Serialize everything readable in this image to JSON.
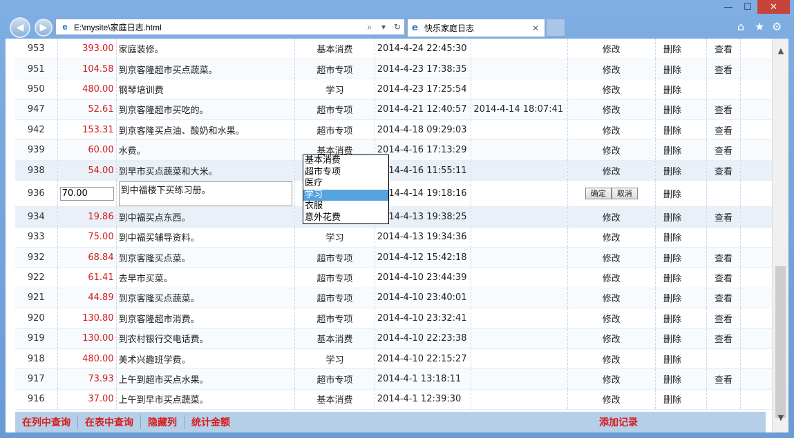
{
  "browser": {
    "address": "E:\\mysite\\家庭日志.html",
    "tab_title": "快乐家庭日志",
    "minimize": "—",
    "maximize": "☐",
    "close": "✕"
  },
  "rows": [
    {
      "id": "953",
      "amount": "393.00",
      "desc": "家庭装修。",
      "cat": "基本消费",
      "time": "2014-4-24 22:45:30",
      "time2": "",
      "edit": "修改",
      "del": "删除",
      "view": "查看"
    },
    {
      "id": "951",
      "amount": "104.58",
      "desc": "到京客隆超市买点蔬菜。",
      "cat": "超市专项",
      "time": "2014-4-23 17:38:35",
      "time2": "",
      "edit": "修改",
      "del": "删除",
      "view": "查看"
    },
    {
      "id": "950",
      "amount": "480.00",
      "desc": "钢琴培训费",
      "cat": "学习",
      "time": "2014-4-23 17:25:54",
      "time2": "",
      "edit": "修改",
      "del": "删除",
      "view": ""
    },
    {
      "id": "947",
      "amount": "52.61",
      "desc": "到京客隆超市买吃的。",
      "cat": "超市专项",
      "time": "2014-4-21 12:40:57",
      "time2": "2014-4-14 18:07:41",
      "edit": "修改",
      "del": "删除",
      "view": "查看"
    },
    {
      "id": "942",
      "amount": "153.31",
      "desc": "到京客隆买点油、酸奶和水果。",
      "cat": "超市专项",
      "time": "2014-4-18 09:29:03",
      "time2": "",
      "edit": "修改",
      "del": "删除",
      "view": "查看"
    },
    {
      "id": "939",
      "amount": "60.00",
      "desc": "水费。",
      "cat": "基本消费",
      "time": "2014-4-16 17:13:29",
      "time2": "",
      "edit": "修改",
      "del": "删除",
      "view": "查看"
    },
    {
      "id": "938",
      "amount": "54.00",
      "desc": "到早市买点蔬菜和大米。",
      "cat": "",
      "time": "2014-4-16 11:55:11",
      "time2": "",
      "edit": "修改",
      "del": "删除",
      "view": "查看"
    },
    {
      "id": "934",
      "amount": "19.86",
      "desc": "到中福买点东西。",
      "cat": "",
      "time": "2014-4-13 19:38:25",
      "time2": "",
      "edit": "修改",
      "del": "删除",
      "view": "查看"
    },
    {
      "id": "933",
      "amount": "75.00",
      "desc": "到中福买辅导资料。",
      "cat": "学习",
      "time": "2014-4-13 19:34:36",
      "time2": "",
      "edit": "修改",
      "del": "删除",
      "view": ""
    },
    {
      "id": "932",
      "amount": "68.84",
      "desc": "到京客隆买点菜。",
      "cat": "超市专项",
      "time": "2014-4-12 15:42:18",
      "time2": "",
      "edit": "修改",
      "del": "删除",
      "view": "查看"
    },
    {
      "id": "922",
      "amount": "61.41",
      "desc": "去早市买菜。",
      "cat": "超市专项",
      "time": "2014-4-10 23:44:39",
      "time2": "",
      "edit": "修改",
      "del": "删除",
      "view": "查看"
    },
    {
      "id": "921",
      "amount": "44.89",
      "desc": "到京客隆买点蔬菜。",
      "cat": "超市专项",
      "time": "2014-4-10 23:40:01",
      "time2": "",
      "edit": "修改",
      "del": "删除",
      "view": "查看"
    },
    {
      "id": "920",
      "amount": "130.80",
      "desc": "到京客隆超市消费。",
      "cat": "超市专项",
      "time": "2014-4-10 23:32:41",
      "time2": "",
      "edit": "修改",
      "del": "删除",
      "view": "查看"
    },
    {
      "id": "919",
      "amount": "130.00",
      "desc": "到农村银行交电话费。",
      "cat": "基本消费",
      "time": "2014-4-10 22:23:38",
      "time2": "",
      "edit": "修改",
      "del": "删除",
      "view": "查看"
    },
    {
      "id": "918",
      "amount": "480.00",
      "desc": "美术兴趣班学费。",
      "cat": "学习",
      "time": "2014-4-10 22:15:27",
      "time2": "",
      "edit": "修改",
      "del": "删除",
      "view": ""
    },
    {
      "id": "917",
      "amount": "73.93",
      "desc": "上午到超市买点水果。",
      "cat": "超市专项",
      "time": "2014-4-1 13:18:11",
      "time2": "",
      "edit": "修改",
      "del": "删除",
      "view": "查看"
    },
    {
      "id": "916",
      "amount": "37.00",
      "desc": "上午到早市买点蔬菜。",
      "cat": "基本消费",
      "time": "2014-4-1 12:39:30",
      "time2": "",
      "edit": "修改",
      "del": "删除",
      "view": ""
    }
  ],
  "edit_row": {
    "id": "936",
    "amount_value": "70.00",
    "desc": "到中福楼下买练习册。",
    "time": "2014-4-14 19:18:16",
    "ok": "确定",
    "cancel": "取消",
    "del": "删除"
  },
  "dropdown": {
    "options": [
      "基本消费",
      "超市专项",
      "医疗",
      "学习",
      "衣服",
      "意外花费"
    ],
    "selected": "学习"
  },
  "footer": {
    "query_col": "在列中查询",
    "query_table": "在表中查询",
    "hide_col": "隐藏列",
    "stat": "统计金额",
    "add": "添加记录"
  }
}
